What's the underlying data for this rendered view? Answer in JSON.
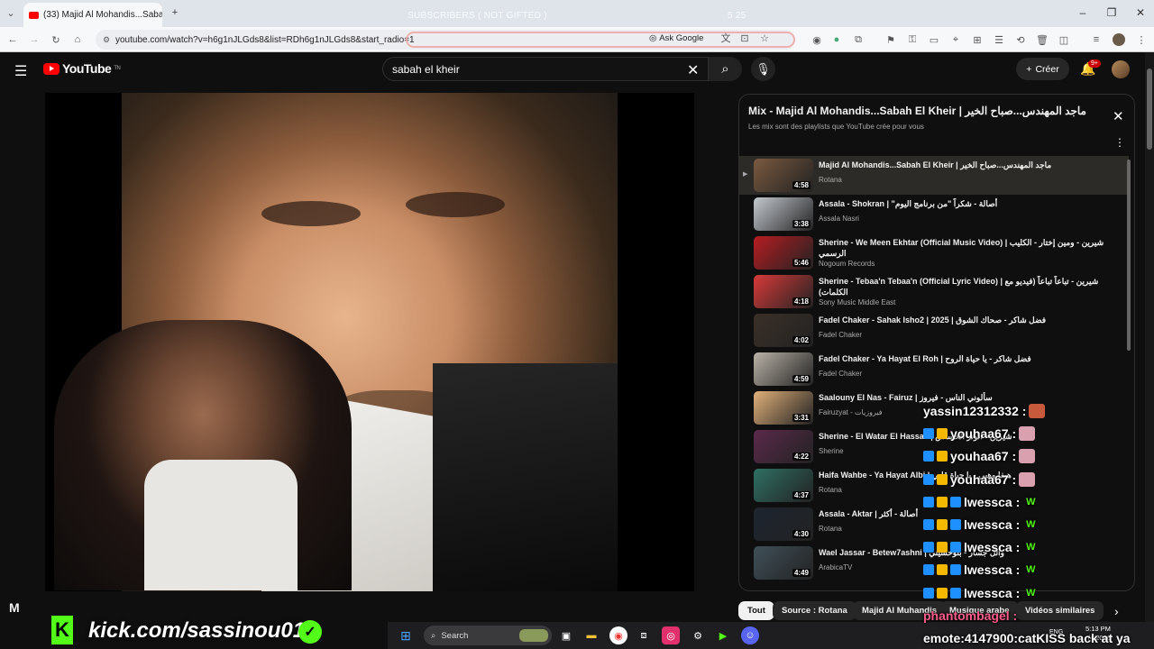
{
  "browser": {
    "tab_title": "(33) Majid Al Mohandis...Sabah",
    "url": "youtube.com/watch?v=h6g1nJLGds8&list=RDh6g1nJLGds8&start_radio=1",
    "ask_google": "Ask Google",
    "stream_overlay": "SUBSCRIBERS ( NOT GIFTED )",
    "stream_counter": "5 25"
  },
  "youtube": {
    "logo": "YouTube",
    "logo_sup": "TN",
    "search_value": "sabah el kheir",
    "create_label": "Créer",
    "notif_count": "9+"
  },
  "playlist": {
    "title": "Mix - Majid Al Mohandis...Sabah El Kheir | ماجد المهندس...صباح الخير",
    "subtitle": "Les mix sont des playlists que YouTube crée pour vous",
    "items": [
      {
        "title": "Majid Al Mohandis...Sabah El Kheir | ماجد المهندس...صباح الخير",
        "channel": "Rotana",
        "duration": "4:58",
        "color": "#7a5a40"
      },
      {
        "title": "Assala - Shokran | \"أصالة - شكراً \"من برنامج اليوم",
        "channel": "Assala Nasri",
        "duration": "3:38",
        "color": "#c4c9cf"
      },
      {
        "title": "Sherine - We Meen Ekhtar (Official Music Video) | شيرين - ومين إختار - الكليب الرسمي",
        "channel": "Nogoum Records",
        "duration": "5:46",
        "color": "#b51d22"
      },
      {
        "title": "Sherine - Tebaa'n Tebaa'n (Official Lyric Video) | شيرين - تباعاً تباعاً (فيديو مع الكلمات)",
        "channel": "Sony Music Middle East",
        "duration": "4:18",
        "color": "#d83a3a"
      },
      {
        "title": "Fadel Chaker - Sahak Isho2 | 2025 | فضل شاكر - صحاك الشوق",
        "channel": "Fadel Chaker",
        "duration": "4:02",
        "color": "#3a3027"
      },
      {
        "title": "Fadel Chaker - Ya Hayat El Roh | فضل شاكر - يا حياة الروح",
        "channel": "Fadel Chaker",
        "duration": "4:59",
        "color": "#b9b2a6"
      },
      {
        "title": "Saalouny El Nas - Fairuz | سألوني الناس - فيروز",
        "channel": "Fairuzyat - فيروزيات",
        "duration": "3:31",
        "color": "#e0b07a"
      },
      {
        "title": "Sherine - El Watar El Hassas | شيرين - الوتر الحساس",
        "channel": "Sherine",
        "duration": "4:22",
        "color": "#5a2a4a"
      },
      {
        "title": "Haifa Wahbe - Ya Hayat Albi | هيفا وهبي - يا حياة قلبي",
        "channel": "Rotana",
        "duration": "4:37",
        "color": "#2f6f63"
      },
      {
        "title": "Assala - Aktar | أصالة - أكثر",
        "channel": "Rotana",
        "duration": "4:30",
        "color": "#1d2530"
      },
      {
        "title": "Wael Jassar - Betew7ashni | وائل جسار - بتوحشيني",
        "channel": "ArabicaTV",
        "duration": "4:49",
        "color": "#3f5058"
      }
    ]
  },
  "chips": [
    "Tout",
    "Source : Rotana",
    "Majid Al Muhandis",
    "Musique arabe",
    "Vidéos similaires"
  ],
  "chat": [
    {
      "user": "yassin12312332 :",
      "color": "#ffffff",
      "badges": 0
    },
    {
      "user": "youhaa67 :",
      "color": "#ffffff",
      "badges": 2
    },
    {
      "user": "youhaa67 :",
      "color": "#ffffff",
      "badges": 2
    },
    {
      "user": "youhaa67 :",
      "color": "#ffffff",
      "badges": 2
    },
    {
      "user": "lwessca :",
      "color": "#ffffff",
      "badges": 3
    },
    {
      "user": "lwessca :",
      "color": "#ffffff",
      "badges": 3
    },
    {
      "user": "lwessca :",
      "color": "#ffffff",
      "badges": 3
    },
    {
      "user": "lwessca :",
      "color": "#ffffff",
      "badges": 3
    },
    {
      "user": "lwessca :",
      "color": "#ffffff",
      "badges": 3
    },
    {
      "user": "phantombagel :",
      "color": "#ff5c8a",
      "badges": 0
    },
    {
      "user": "emote:4147900:catKISS back at ya",
      "color": "#ffffff",
      "badges": 0
    }
  ],
  "kick": {
    "url": "kick.com/sassinou01",
    "logo_letter": "K"
  },
  "taskbar": {
    "search": "Search",
    "lang": "ENG",
    "time": "5:13 PM",
    "date": "/4/2026"
  },
  "video_overlay_text": "M"
}
